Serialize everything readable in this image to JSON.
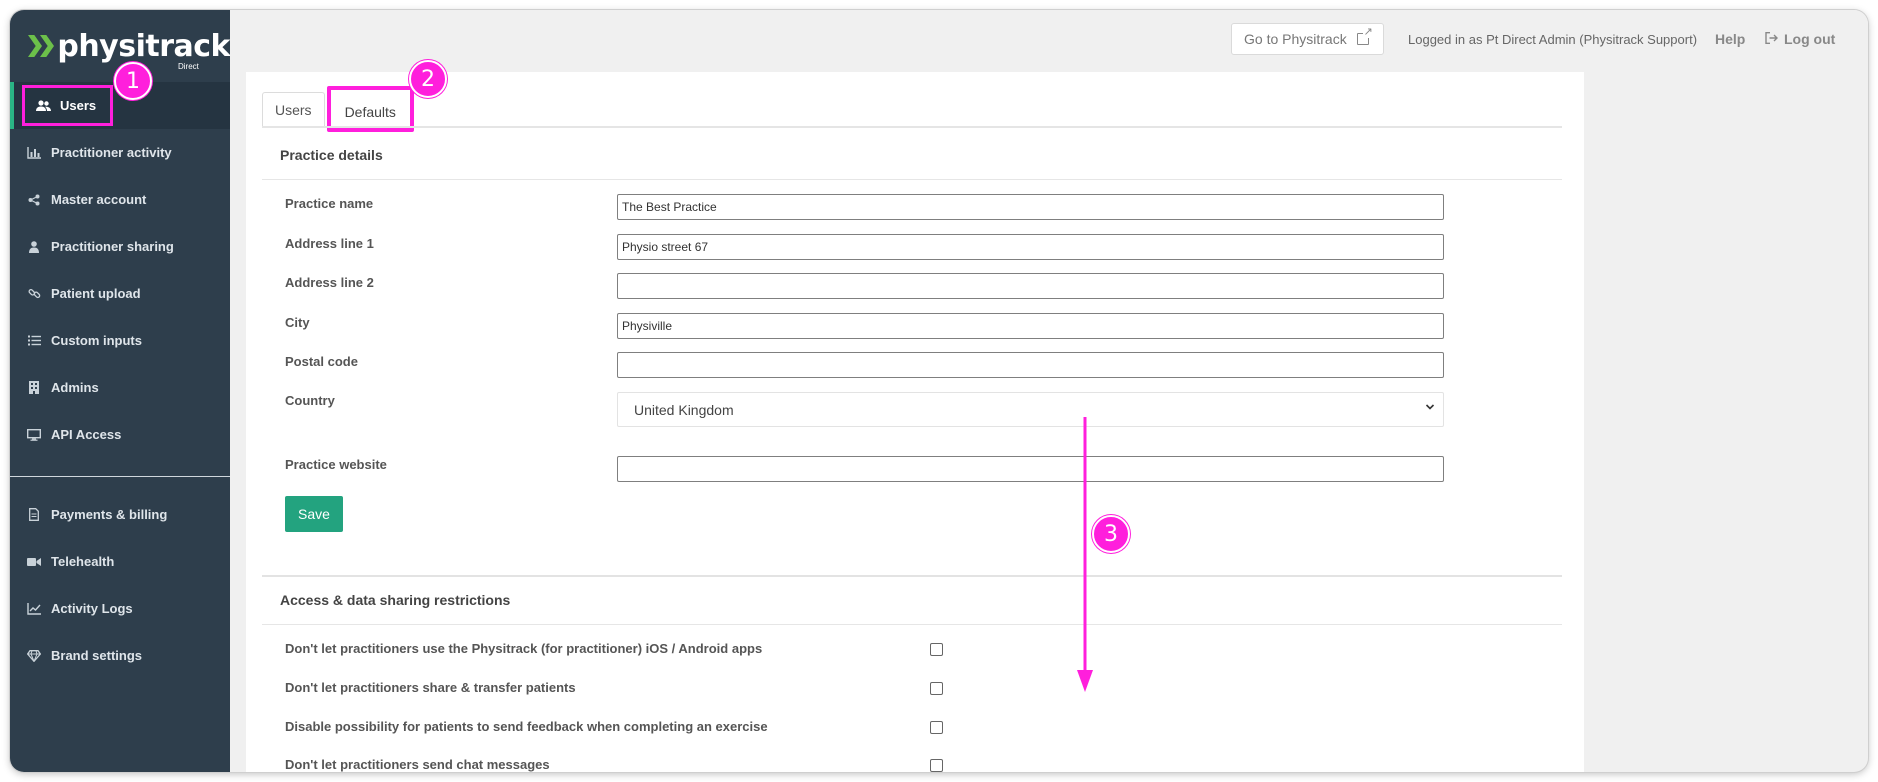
{
  "brand": {
    "name": "physitrack",
    "sub": "Direct"
  },
  "sidebar": {
    "items": [
      {
        "label": "Users",
        "icon": "users-icon"
      },
      {
        "label": "Practitioner activity",
        "icon": "bar-chart-icon"
      },
      {
        "label": "Master account",
        "icon": "share-icon"
      },
      {
        "label": "Practitioner sharing",
        "icon": "user-icon"
      },
      {
        "label": "Patient upload",
        "icon": "link-icon"
      },
      {
        "label": "Custom inputs",
        "icon": "list-icon"
      },
      {
        "label": "Admins",
        "icon": "building-icon"
      },
      {
        "label": "API Access",
        "icon": "monitor-icon"
      }
    ],
    "items2": [
      {
        "label": "Payments & billing",
        "icon": "document-icon"
      },
      {
        "label": "Telehealth",
        "icon": "video-icon"
      },
      {
        "label": "Activity Logs",
        "icon": "line-chart-icon"
      },
      {
        "label": "Brand settings",
        "icon": "diamond-icon"
      }
    ]
  },
  "topbar": {
    "goto": "Go to Physitrack",
    "logged_in": "Logged in as Pt Direct Admin (Physitrack Support)",
    "help": "Help",
    "logout": "Log out"
  },
  "tabs": [
    {
      "label": "Users"
    },
    {
      "label": "Defaults"
    }
  ],
  "practice": {
    "title": "Practice details",
    "fields": {
      "name": {
        "label": "Practice name",
        "value": "The Best Practice"
      },
      "address1": {
        "label": "Address line 1",
        "value": "Physio street 67"
      },
      "address2": {
        "label": "Address line 2",
        "value": ""
      },
      "city": {
        "label": "City",
        "value": "Physiville"
      },
      "postal": {
        "label": "Postal code",
        "value": ""
      },
      "country": {
        "label": "Country",
        "value": "United Kingdom"
      },
      "website": {
        "label": "Practice website",
        "value": ""
      }
    },
    "save": "Save"
  },
  "access": {
    "title": "Access & data sharing restrictions",
    "items": [
      {
        "label": "Don't let practitioners use the Physitrack (for practitioner) iOS / Android apps"
      },
      {
        "label": "Don't let practitioners share & transfer patients"
      },
      {
        "label": "Disable possibility for patients to send feedback when completing an exercise"
      },
      {
        "label": "Don't let practitioners send chat messages"
      }
    ]
  },
  "annotations": {
    "badge1": "1",
    "badge2": "2",
    "badge3": "3",
    "color": "#ff1fdc"
  },
  "colors": {
    "sidebar": "#2e3e4c",
    "accent": "#23a37f",
    "brand_green": "#6cc04a"
  }
}
